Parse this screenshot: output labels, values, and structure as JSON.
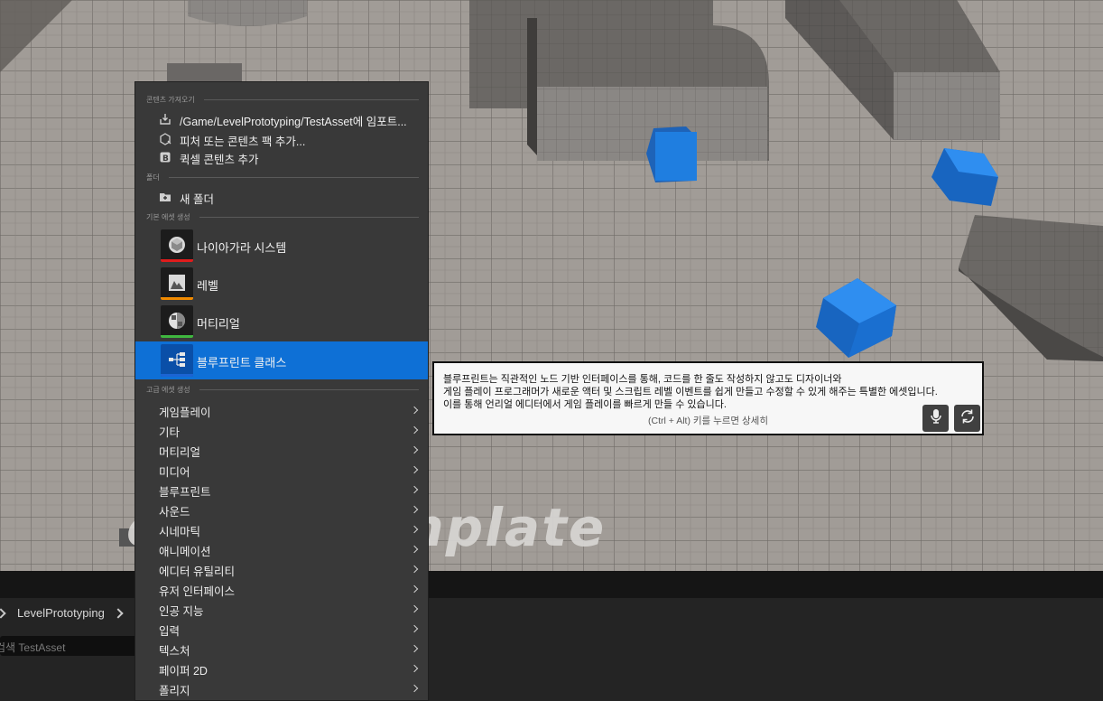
{
  "viewport": {
    "watermark_text": "erson Template"
  },
  "menu": {
    "sections": {
      "import": "콘텐츠 가져오기",
      "folder": "폴더",
      "basic_assets": "기본 에셋 생성",
      "advanced_assets": "고급 에셋 생성"
    },
    "import_items": [
      {
        "icon": "import-icon",
        "label": "/Game/LevelPrototyping/TestAsset에 임포트..."
      },
      {
        "icon": "feature-pack-icon",
        "label": "피처 또는 콘텐츠 팩 추가..."
      },
      {
        "icon": "quixel-icon",
        "label": "퀵셀 콘텐츠 추가"
      }
    ],
    "folder_item": {
      "icon": "new-folder-icon",
      "label": "새 폴더"
    },
    "basic_assets": [
      {
        "icon": "niagara-icon",
        "label": "나이아가라 시스템",
        "color": "#e01c1c"
      },
      {
        "icon": "level-icon",
        "label": "레벨",
        "color": "#f08a00"
      },
      {
        "icon": "material-icon",
        "label": "머티리얼",
        "color": "#3fb73f"
      },
      {
        "icon": "blueprint-icon",
        "label": "블루프린트 클래스",
        "color": "#1b64d4"
      }
    ],
    "highlighted": "블루프린트 클래스",
    "advanced_categories": [
      "게임플레이",
      "기타",
      "머티리얼",
      "미디어",
      "블루프린트",
      "사운드",
      "시네마틱",
      "애니메이션",
      "에디터 유틸리티",
      "유저 인터페이스",
      "인공 지능",
      "입력",
      "텍스처",
      "페이퍼 2D",
      "폴리지"
    ]
  },
  "tooltip": {
    "lines": [
      "블루프린트는 직관적인 노드 기반 인터페이스를 통해, 코드를 한 줄도 작성하지 않고도 디자이너와",
      "게임 플레이 프로그래머가 새로운 액터 및 스크립트 레벨 이벤트를 쉽게 만들고 수정할 수 있게 해주는 특별한 에셋입니다.",
      "이를 통해 언리얼 에디터에서 게임 플레이를 빠르게 만들 수 있습니다."
    ],
    "hint": "(Ctrl + Alt) 키를 누르면 상세히",
    "buttons": [
      "microphone-icon",
      "refresh-icon"
    ]
  },
  "content_browser": {
    "breadcrumb": "LevelPrototyping",
    "search_placeholder": "검색 TestAsset"
  },
  "colors": {
    "highlight": "#0e70d6",
    "menu_bg": "#393939",
    "cube": "#1f7ee0"
  }
}
